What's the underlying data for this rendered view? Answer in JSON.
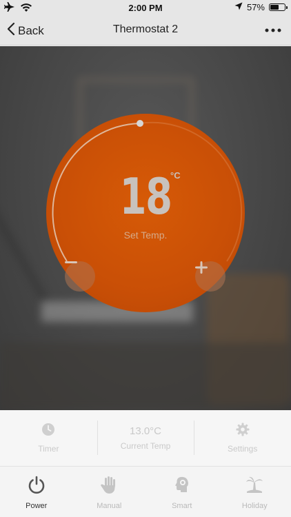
{
  "status_bar": {
    "time": "2:00 PM",
    "battery": "57%"
  },
  "nav": {
    "back_label": "Back",
    "title": "Thermostat 2"
  },
  "dial": {
    "temperature": "18",
    "unit": "°C",
    "label": "Set Temp."
  },
  "info_bar": {
    "timer_label": "Timer",
    "current_temp_value": "13.0°C",
    "current_temp_label": "Current Temp",
    "settings_label": "Settings"
  },
  "tabs": [
    {
      "label": "Power",
      "icon": "power-icon",
      "active": true
    },
    {
      "label": "Manual",
      "icon": "hand-icon",
      "active": false
    },
    {
      "label": "Smart",
      "icon": "head-brain-icon",
      "active": false
    },
    {
      "label": "Holiday",
      "icon": "palm-tree-icon",
      "active": false
    }
  ],
  "colors": {
    "dial": "#c94f06",
    "nav_background": "#e6e6e6",
    "active_tab": "#333333",
    "inactive_tab": "#b9b9b9"
  }
}
